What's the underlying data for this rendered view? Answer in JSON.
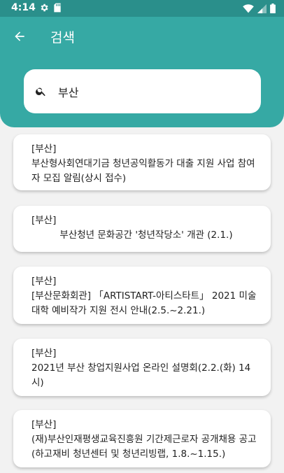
{
  "status_bar": {
    "time": "4:14"
  },
  "app_bar": {
    "title": "검색"
  },
  "search": {
    "value": "부산"
  },
  "results": [
    {
      "tag": "[부산]",
      "title": "부산형사회연대기금 청년공익활동가 대출 지원 사업 참여자 모집 알림(상시 접수)"
    },
    {
      "tag": "[부산]",
      "title": "부산청년 문화공간 '청년작당소' 개관 (2.1.)"
    },
    {
      "tag": "[부산]",
      "title": "[부산문화회관] 「ARTISTART-아티스타트」 2021 미술대학 예비작가 지원 전시 안내(2.5.~2.21.)"
    },
    {
      "tag": "[부산]",
      "title": "2021년 부산 창업지원사업 온라인 설명회(2.2.(화) 14시)"
    },
    {
      "tag": "[부산]",
      "title": "(재)부산인재평생교육진흥원 기간제근로자 공개채용 공고(하고재비 청년센터 및 청년리빙랩, 1.8.~1.15.)"
    }
  ]
}
